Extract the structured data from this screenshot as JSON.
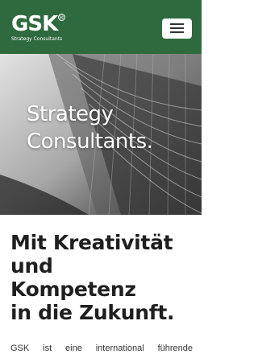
{
  "header": {
    "logo_text": "GSK",
    "logo_reg": "®",
    "logo_subtitle": "Strategy Consultants",
    "menu_icon": "hamburger-menu-icon",
    "bg_color": "#2f6a3f"
  },
  "hero": {
    "title_line1": "Strategy",
    "title_line2": "Consultants."
  },
  "main": {
    "headline_line1": "Mit Kreativität",
    "headline_line2": "und",
    "headline_line3": "Kompetenz",
    "headline_line4": "in die Zukunft.",
    "body_text": "GSK ist eine international führende"
  }
}
